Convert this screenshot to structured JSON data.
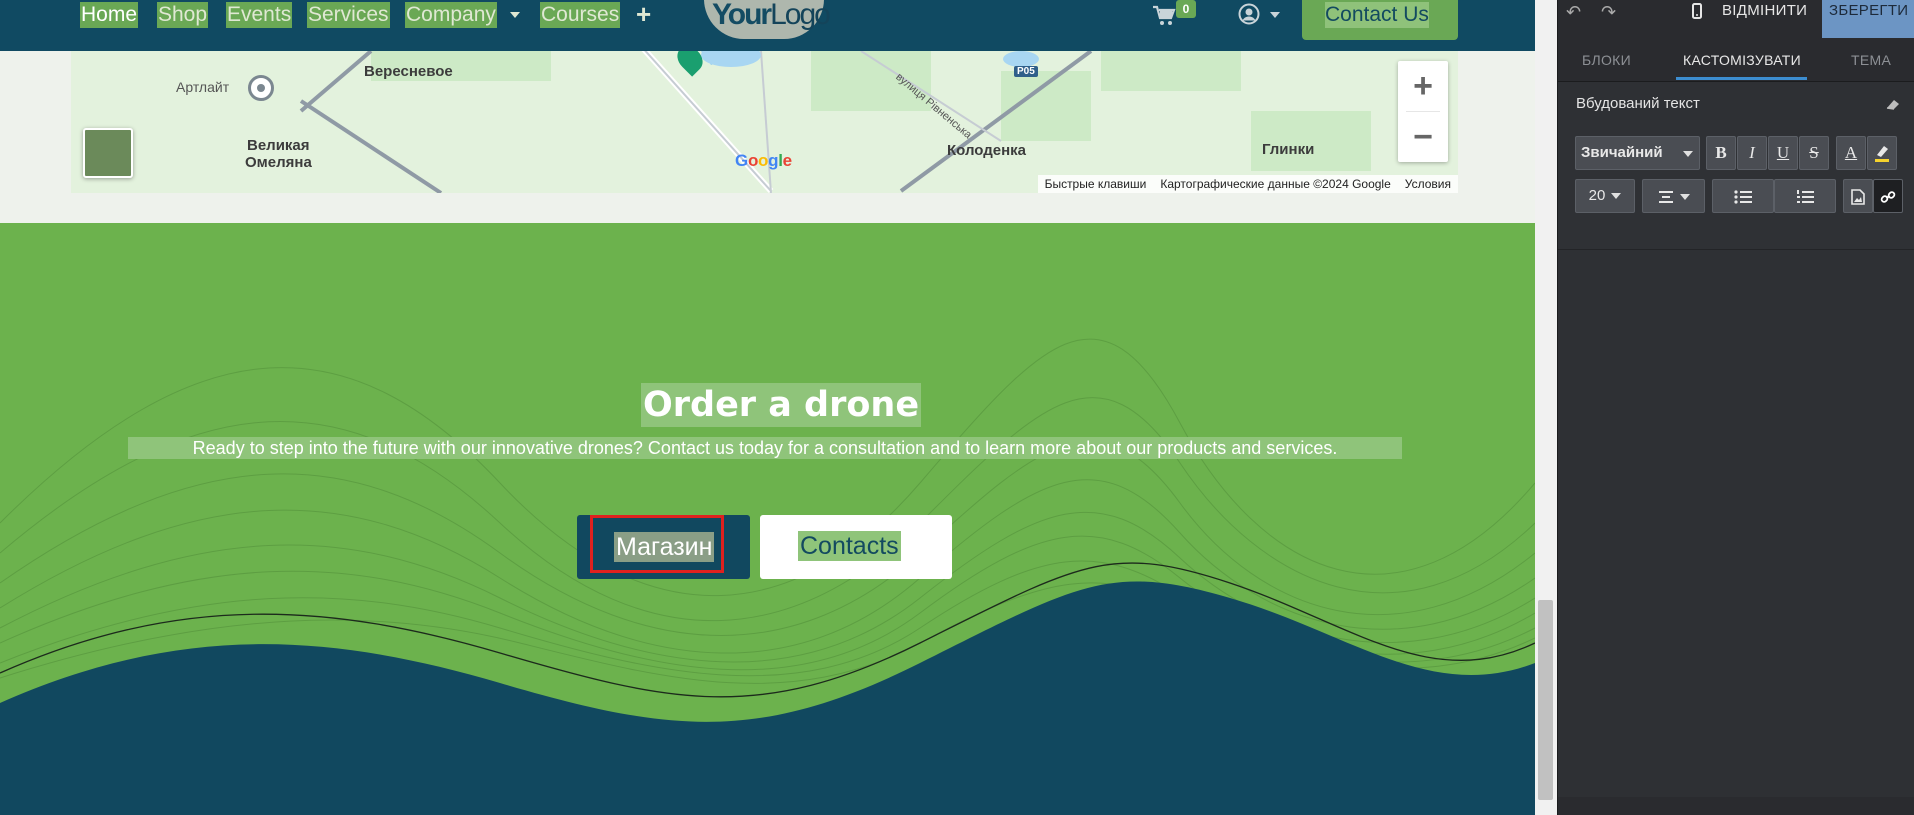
{
  "site": {
    "nav": {
      "items": [
        {
          "label": "Home",
          "active": true
        },
        {
          "label": "Shop"
        },
        {
          "label": "Events"
        },
        {
          "label": "Services"
        },
        {
          "label": "Company"
        },
        {
          "label": "Courses"
        }
      ],
      "plus": "+",
      "logo_part1": "Your",
      "logo_part2": "Logo",
      "cart_count": "0",
      "contact_button": "Contact Us"
    },
    "map": {
      "labels": {
        "artlait": "Артлайт",
        "veresnevoe": "Вересневое",
        "velikaya": "Великая",
        "omelyana": "Омеляна",
        "kolodenka": "Колоденка",
        "glinki": "Глинки",
        "street": "вулиця Рівненська",
        "road_badge": "P05"
      },
      "google": "Google",
      "footer": {
        "shortcuts": "Быстрые клавиши",
        "map_data": "Картографические данные ©2024 Google",
        "terms": "Условия"
      },
      "zoom_in": "+",
      "zoom_out": "−"
    },
    "hero": {
      "title": "Order a drone",
      "subtitle": "Ready to step into the future with our innovative drones? Contact us today for a consultation and to learn more about our products and services.",
      "shop_button": "Магазин",
      "contacts_button": "Contacts"
    },
    "colors": {
      "nav": "#104a62",
      "green": "#6cb24d",
      "highlight": "#8fc47a",
      "selection_outline": "#e0211f"
    }
  },
  "panel": {
    "cancel": "ВІДМІНИТИ",
    "save": "ЗБЕРЕГТИ",
    "tabs": [
      {
        "label": "БЛОКИ"
      },
      {
        "label": "КАСТОМІЗУВАТИ",
        "active": true
      },
      {
        "label": "ТЕМА"
      }
    ],
    "section_title": "Вбудований текст",
    "toolbar": {
      "style_value": "Звичайний",
      "bold": "B",
      "italic": "I",
      "underline": "U",
      "strike": "S",
      "font_color": "A",
      "size_value": "20"
    }
  }
}
